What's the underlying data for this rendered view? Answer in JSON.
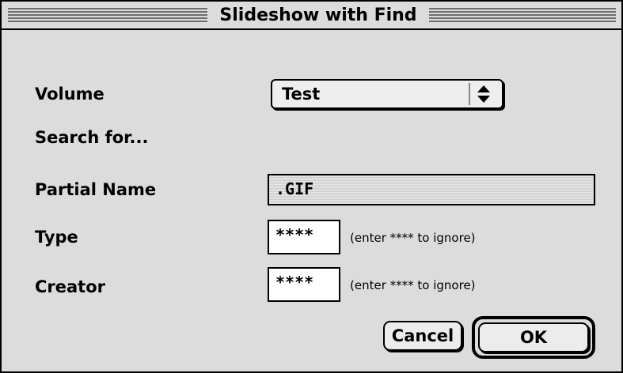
{
  "window": {
    "title": "Slideshow with Find"
  },
  "form": {
    "volume_label": "Volume",
    "volume_value": "Test",
    "search_for_label": "Search for...",
    "partial_name_label": "Partial Name",
    "partial_name_value": ".GIF",
    "type_label": "Type",
    "type_value": "****",
    "type_hint": "(enter **** to ignore)",
    "creator_label": "Creator",
    "creator_value": "****",
    "creator_hint": "(enter **** to ignore)"
  },
  "buttons": {
    "cancel_label": "Cancel",
    "ok_label": "OK"
  },
  "icons": {
    "popup_arrows": "up-down-arrows-icon"
  }
}
